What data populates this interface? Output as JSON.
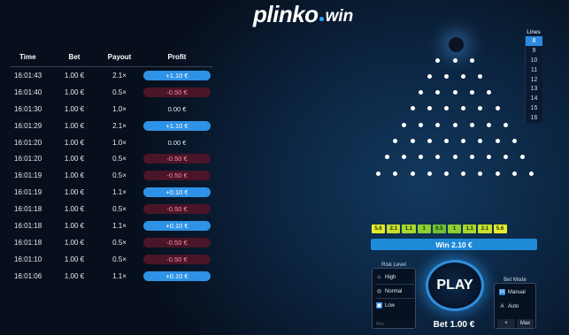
{
  "logo": {
    "main": "plinko",
    "sub": "win"
  },
  "history": {
    "headers": {
      "time": "Time",
      "bet": "Bet",
      "payout": "Payout",
      "profit": "Profit"
    },
    "rows": [
      {
        "time": "16:01:43",
        "bet": "1.00 €",
        "payout": "2.1×",
        "profit": "+1.10 €",
        "status": "win"
      },
      {
        "time": "16:01:40",
        "bet": "1.00 €",
        "payout": "0.5×",
        "profit": "-0.50 €",
        "status": "loss"
      },
      {
        "time": "16:01:30",
        "bet": "1.00 €",
        "payout": "1.0×",
        "profit": "0.00 €",
        "status": "zero"
      },
      {
        "time": "16:01:29",
        "bet": "1.00 €",
        "payout": "2.1×",
        "profit": "+1.10 €",
        "status": "win"
      },
      {
        "time": "16:01:20",
        "bet": "1.00 €",
        "payout": "1.0×",
        "profit": "0.00 €",
        "status": "zero"
      },
      {
        "time": "16:01:20",
        "bet": "1.00 €",
        "payout": "0.5×",
        "profit": "-0.50 €",
        "status": "loss"
      },
      {
        "time": "16:01:19",
        "bet": "1.00 €",
        "payout": "0.5×",
        "profit": "-0.50 €",
        "status": "loss"
      },
      {
        "time": "16:01:19",
        "bet": "1.00 €",
        "payout": "1.1×",
        "profit": "+0.10 €",
        "status": "win"
      },
      {
        "time": "16:01:18",
        "bet": "1.00 €",
        "payout": "0.5×",
        "profit": "-0.50 €",
        "status": "loss"
      },
      {
        "time": "16:01:18",
        "bet": "1.00 €",
        "payout": "1.1×",
        "profit": "+0.10 €",
        "status": "win"
      },
      {
        "time": "16:01:18",
        "bet": "1.00 €",
        "payout": "0.5×",
        "profit": "-0.50 €",
        "status": "loss"
      },
      {
        "time": "16:01:10",
        "bet": "1.00 €",
        "payout": "0.5×",
        "profit": "-0.50 €",
        "status": "loss"
      },
      {
        "time": "16:01:06",
        "bet": "1.00 €",
        "payout": "1.1×",
        "profit": "+0.10 €",
        "status": "win"
      }
    ]
  },
  "lines": {
    "title": "Lines",
    "options": [
      "8",
      "9",
      "10",
      "11",
      "12",
      "13",
      "14",
      "15",
      "16"
    ],
    "selected": "8"
  },
  "board": {
    "rows": 8
  },
  "multipliers": [
    {
      "label": "5.6",
      "color": "#e6ec2a"
    },
    {
      "label": "2.1",
      "color": "#c8e02a"
    },
    {
      "label": "1.1",
      "color": "#a8d82c"
    },
    {
      "label": "1",
      "color": "#8ccf2f"
    },
    {
      "label": "0.5",
      "color": "#6fc232"
    },
    {
      "label": "1",
      "color": "#8ccf2f"
    },
    {
      "label": "1.1",
      "color": "#a8d82c"
    },
    {
      "label": "2.1",
      "color": "#c8e02a"
    },
    {
      "label": "5.6",
      "color": "#e6ec2a"
    }
  ],
  "win_banner": "Win 2.10 €",
  "risk": {
    "title": "Risk Level",
    "options": [
      {
        "label": "High",
        "icon": "flame-icon",
        "glyph": "♨"
      },
      {
        "label": "Normal",
        "icon": "target-icon",
        "glyph": "◎"
      },
      {
        "label": "Low",
        "icon": "shield-icon",
        "glyph": "▣"
      }
    ],
    "selected": "Low",
    "min_label": "Min"
  },
  "play": {
    "label": "PLAY",
    "bet": "Bet 1.00 €"
  },
  "bet_mode": {
    "title": "Bet Mode",
    "options": [
      {
        "label": "Manual",
        "icon": "manual-icon",
        "glyph": "M"
      },
      {
        "label": "Auto",
        "icon": "auto-icon",
        "glyph": "A"
      }
    ],
    "selected": "Manual",
    "plus_label": "+",
    "max_label": "Max"
  },
  "colors": {
    "accent": "#2a8be0",
    "win_pill": "#2e93e6",
    "loss_pill": "#4a1528",
    "loss_text": "#ff8aa2"
  }
}
